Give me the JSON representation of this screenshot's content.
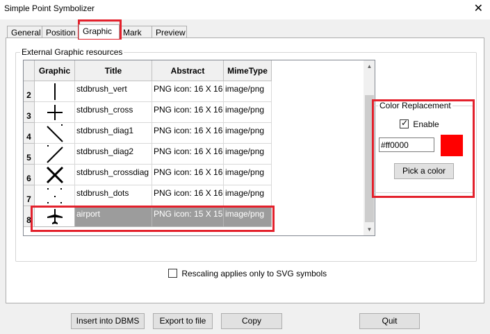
{
  "window": {
    "title": "Simple Point Symbolizer",
    "close_glyph": "✕"
  },
  "tabs": [
    {
      "label": "General",
      "active": false
    },
    {
      "label": "Position",
      "active": false
    },
    {
      "label": "Graphic",
      "active": true
    },
    {
      "label": "Mark",
      "active": false
    },
    {
      "label": "Preview",
      "active": false
    }
  ],
  "resources": {
    "group_title": "External Graphic resources",
    "columns": [
      "Graphic",
      "Title",
      "Abstract",
      "MimeType"
    ],
    "rows": [
      {
        "num": "2",
        "icon": "vertical-line-icon",
        "title": "stdbrush_vert",
        "abstract": "PNG icon: 16 X 16",
        "mime": "image/png",
        "selected": false
      },
      {
        "num": "3",
        "icon": "cross-icon",
        "title": "stdbrush_cross",
        "abstract": "PNG icon: 16 X 16",
        "mime": "image/png",
        "selected": false
      },
      {
        "num": "4",
        "icon": "diagonal-down-icon",
        "title": "stdbrush_diag1",
        "abstract": "PNG icon: 16 X 16",
        "mime": "image/png",
        "selected": false
      },
      {
        "num": "5",
        "icon": "diagonal-up-icon",
        "title": "stdbrush_diag2",
        "abstract": "PNG icon: 16 X 16",
        "mime": "image/png",
        "selected": false
      },
      {
        "num": "6",
        "icon": "crossdiag-icon",
        "title": "stdbrush_crossdiag",
        "abstract": "PNG icon: 16 X 16",
        "mime": "image/png",
        "selected": false
      },
      {
        "num": "7",
        "icon": "dots-icon",
        "title": "stdbrush_dots",
        "abstract": "PNG icon: 16 X 16",
        "mime": "image/png",
        "selected": false
      },
      {
        "num": "8",
        "icon": "airplane-icon",
        "title": "airport",
        "abstract": "PNG icon: 15 X 15",
        "mime": "image/png",
        "selected": true
      }
    ]
  },
  "color_replacement": {
    "title": "Color Replacement",
    "enable_label": "Enable",
    "enabled": true,
    "color_value": "#ff0000",
    "swatch_color": "#ff0000",
    "pick_label": "Pick a color"
  },
  "rescaling": {
    "label": "Rescaling applies only to SVG symbols",
    "checked": false
  },
  "buttons": {
    "insert": "Insert into DBMS",
    "export": "Export to file",
    "copy": "Copy",
    "quit": "Quit"
  },
  "colors": {
    "highlight": "#e3212c",
    "selected_row": "#9c9c9c"
  }
}
